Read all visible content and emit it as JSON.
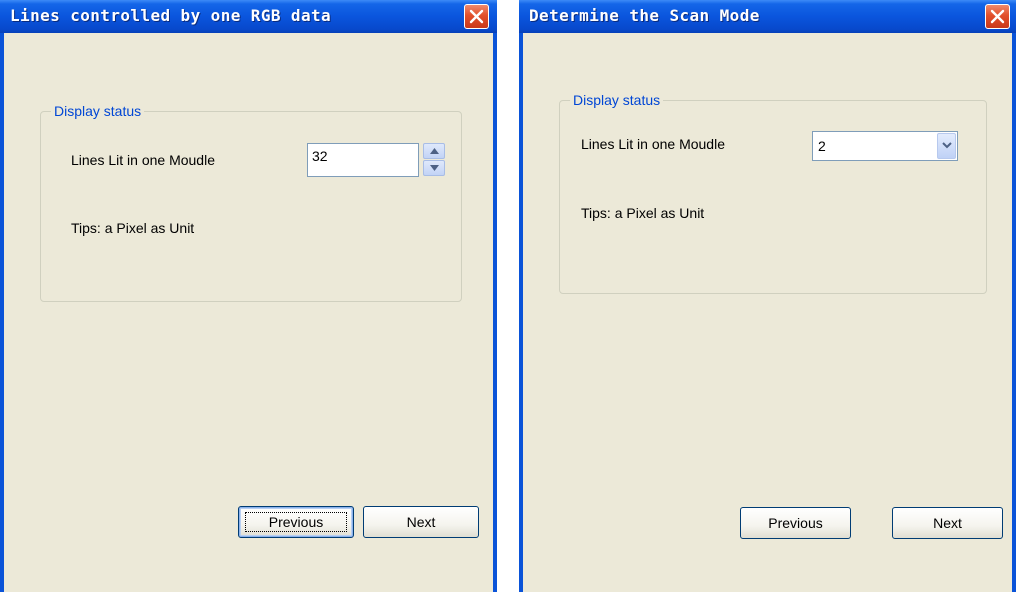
{
  "left_window": {
    "title": "Lines controlled by one RGB data",
    "group_title": "Display status",
    "field_label": "Lines Lit in one Moudle",
    "spin_value": "32",
    "tip": "Tips: a Pixel as Unit",
    "previous_label": "Previous",
    "next_label": "Next"
  },
  "right_window": {
    "title": "Determine the Scan Mode",
    "group_title": "Display status",
    "field_label": "Lines Lit in one Moudle",
    "combo_value": "2",
    "tip": "Tips: a Pixel as Unit",
    "previous_label": "Previous",
    "next_label": "Next"
  },
  "colors": {
    "titlebar": "#0a55dd",
    "window_face": "#ece9d8",
    "group_legend": "#0046d5",
    "close_button": "#e2502b"
  },
  "icons": {
    "close": "close-icon",
    "spin_up": "arrow-up-icon",
    "spin_down": "arrow-down-icon",
    "combo_dropdown": "chevron-down-icon"
  }
}
